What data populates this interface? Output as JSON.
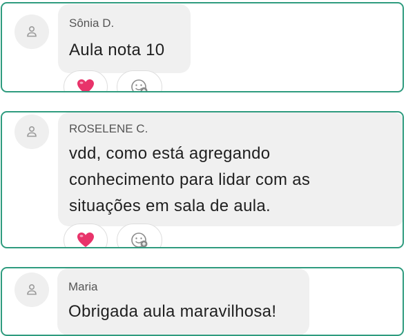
{
  "comments": [
    {
      "author": "Sônia D.",
      "text_lines": [
        "Aula nota 10"
      ],
      "reactions": [
        {
          "icon": "heart-emoji-icon"
        },
        {
          "icon": "add-reaction-icon"
        }
      ]
    },
    {
      "author": "ROSELENE C.",
      "text_lines": [
        "vdd, como está agregando",
        "conhecimento para lidar com as",
        "situações em sala de aula."
      ],
      "reactions": [
        {
          "icon": "heart-emoji-icon"
        },
        {
          "icon": "add-reaction-icon"
        }
      ]
    },
    {
      "author": "Maria",
      "text_lines": [
        "Obrigada aula maravilhosa!"
      ],
      "reactions": []
    }
  ],
  "colors": {
    "card_border": "#2e9b7e",
    "bubble_bg": "#f0f0f0",
    "heart": "#e8336a"
  }
}
